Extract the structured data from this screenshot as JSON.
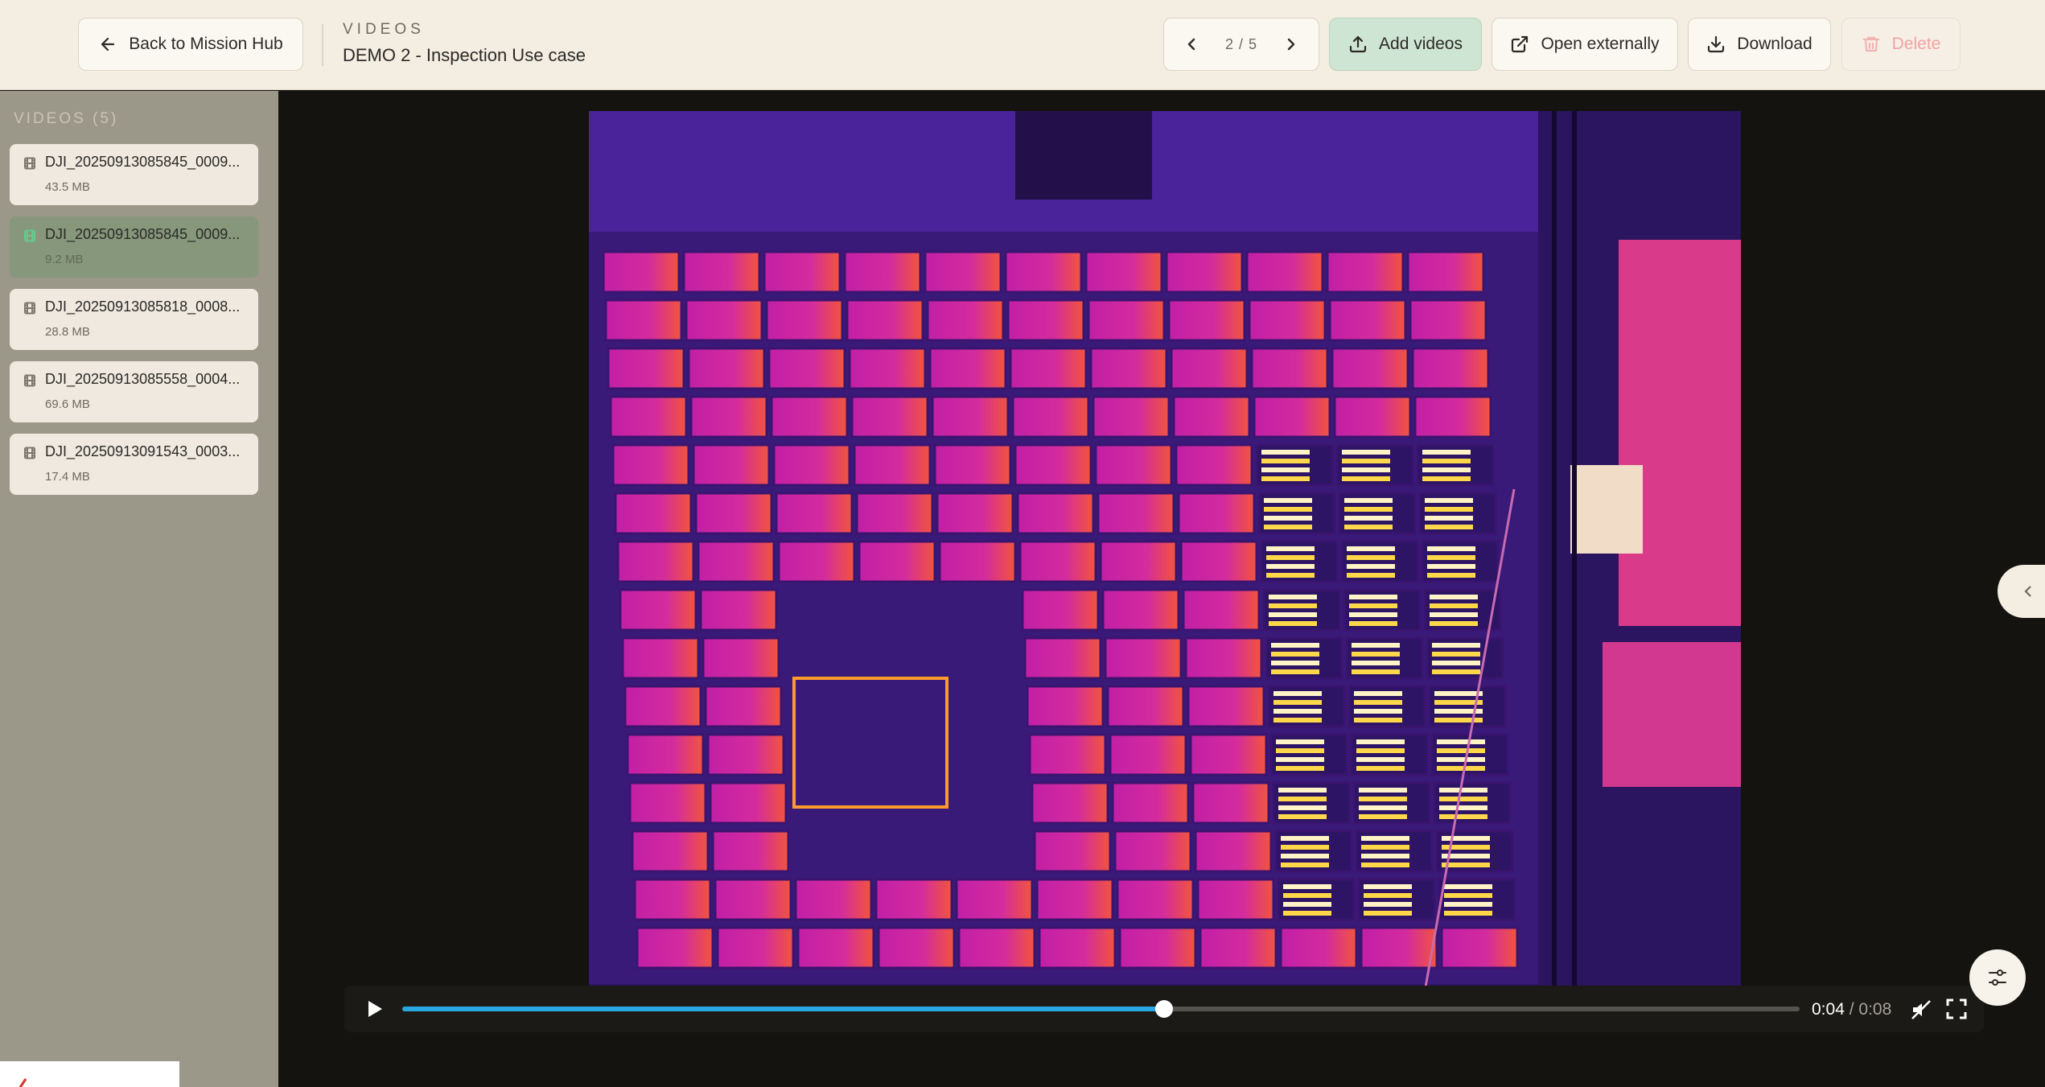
{
  "header": {
    "back_label": "Back to Mission Hub",
    "kicker": "VIDEOS",
    "title": "DEMO 2 - Inspection Use case",
    "pager": "2 / 5",
    "add_label": "Add videos",
    "open_label": "Open externally",
    "download_label": "Download",
    "delete_label": "Delete"
  },
  "sidebar": {
    "title": "VIDEOS (5)",
    "items": [
      {
        "name": "DJI_20250913085845_0009...",
        "size": "43.5 MB",
        "active": false
      },
      {
        "name": "DJI_20250913085845_0009...",
        "size": "9.2 MB",
        "active": true
      },
      {
        "name": "DJI_20250913085818_0008...",
        "size": "28.8 MB",
        "active": false
      },
      {
        "name": "DJI_20250913085558_0004...",
        "size": "69.6 MB",
        "active": false
      },
      {
        "name": "DJI_20250913091543_0003...",
        "size": "17.4 MB",
        "active": false
      }
    ]
  },
  "player": {
    "current_time": "0:04",
    "separator": "/",
    "duration": "0:08",
    "progress": 0.545
  },
  "colors": {
    "accent": "#29a7e1",
    "header_bg": "#f3ede2",
    "sidebar_bg": "#9b9789",
    "active_item": "#86977c",
    "add_button": "#cfe5d3",
    "delete_text": "#f2a3a3"
  },
  "icons": [
    "arrow-left-icon",
    "chevron-left-icon",
    "chevron-right-icon",
    "upload-icon",
    "external-link-icon",
    "download-icon",
    "trash-icon",
    "film-icon",
    "play-icon",
    "mute-icon",
    "fullscreen-icon",
    "sliders-icon"
  ]
}
